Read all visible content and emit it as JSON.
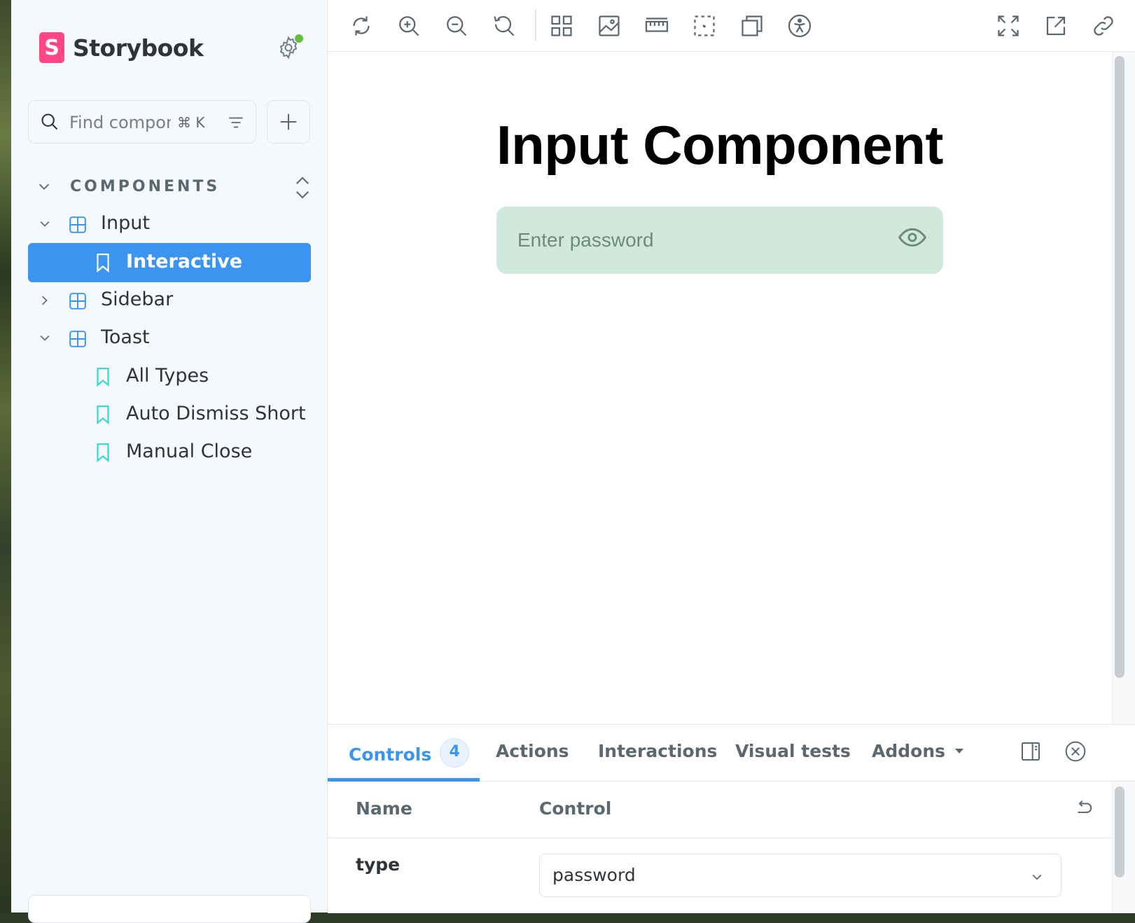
{
  "app": {
    "name": "Storybook",
    "logo_letter": "S",
    "brand_color": "#ff4785",
    "accent_color": "#3b95f0"
  },
  "sidebar": {
    "search_placeholder": "Find components",
    "search_shortcut": "⌘ K",
    "section_label": "COMPONENTS",
    "tree": [
      {
        "label": "Input",
        "type": "component",
        "expanded": true
      },
      {
        "label": "Interactive",
        "type": "story",
        "selected": true
      },
      {
        "label": "Sidebar",
        "type": "component",
        "expanded": false
      },
      {
        "label": "Toast",
        "type": "component",
        "expanded": true
      },
      {
        "label": "All Types",
        "type": "story"
      },
      {
        "label": "Auto Dismiss Short",
        "type": "story"
      },
      {
        "label": "Manual Close",
        "type": "story"
      }
    ]
  },
  "toolbar": {
    "icons": [
      "reload-icon",
      "zoom-in-icon",
      "zoom-out-icon",
      "zoom-reset-icon",
      "grid-icon",
      "background-icon",
      "measure-icon",
      "outline-icon",
      "viewport-icon",
      "accessibility-icon",
      "fullscreen-icon",
      "open-new-tab-icon",
      "copy-link-icon"
    ]
  },
  "canvas": {
    "title": "Input Component",
    "input_placeholder": "Enter password",
    "input_bg_color": "#d0e9dc"
  },
  "panel": {
    "tabs": [
      {
        "label": "Controls",
        "badge": "4",
        "active": true
      },
      {
        "label": "Actions"
      },
      {
        "label": "Interactions"
      },
      {
        "label": "Visual tests"
      },
      {
        "label": "Addons"
      }
    ],
    "columns": {
      "name": "Name",
      "control": "Control"
    },
    "rows": [
      {
        "name": "type",
        "value": "password"
      }
    ]
  }
}
